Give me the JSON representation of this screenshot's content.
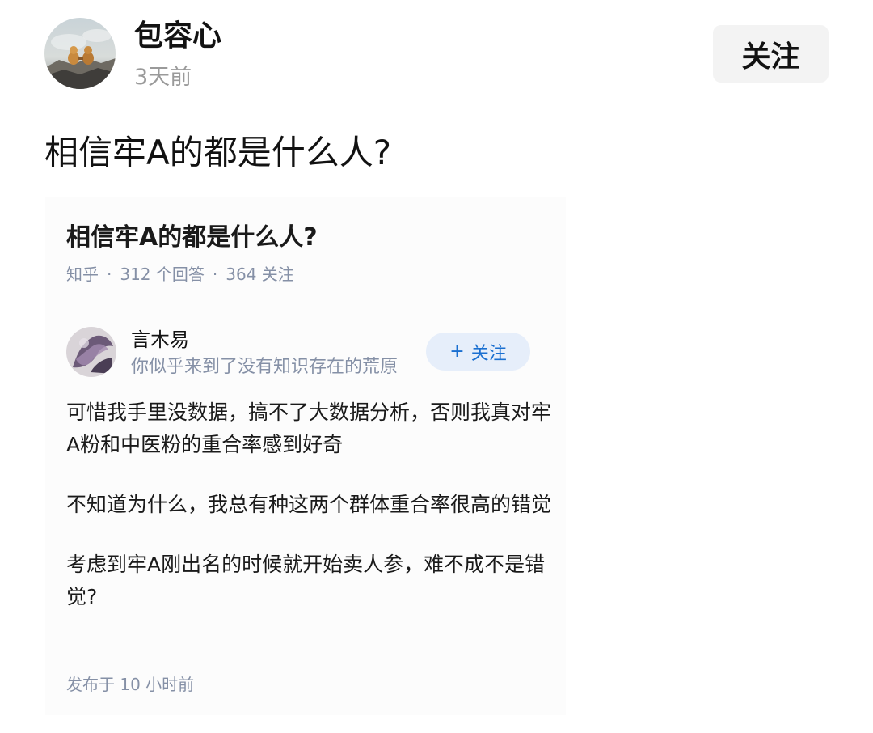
{
  "post": {
    "author_name": "包容心",
    "time": "3天前",
    "follow_label": "关注",
    "title": "相信牢A的都是什么人?"
  },
  "screenshot": {
    "question_title": "相信牢A的都是什么人?",
    "meta": {
      "source": "知乎",
      "separator": "·",
      "answers": "312 个回答",
      "followers": "364 关注"
    },
    "answer": {
      "author_name": "言木易",
      "author_bio": "你似乎来到了没有知识存在的荒原",
      "follow_plus": "+",
      "follow_label": "关注",
      "paragraphs": [
        "可惜我手里没数据，搞不了大数据分析，否则我真对牢A粉和中医粉的重合率感到好奇",
        "不知道为什么，我总有种这两个群体重合率很高的错觉",
        "考虑到牢A刚出名的时候就开始卖人参，难不成不是错觉?"
      ],
      "published": "发布于 10 小时前"
    }
  }
}
